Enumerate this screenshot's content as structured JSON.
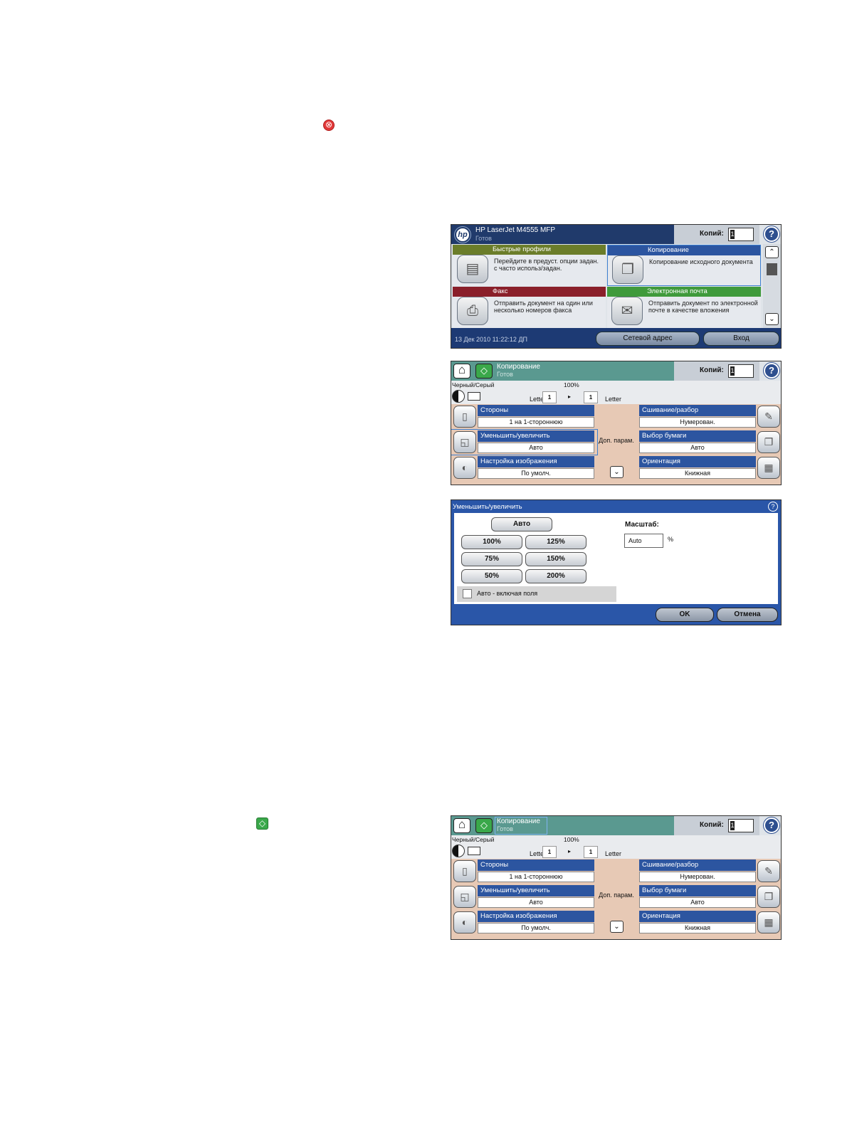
{
  "home_screen": {
    "device_name": "HP LaserJet M4555 MFP",
    "status": "Готов",
    "copies_label": "Копий:",
    "copies_value": "1",
    "tiles": [
      {
        "name": "Быстрые профили",
        "desc": "Перейдите в предуст. опции задан. с часто использ/задан.",
        "color": "#6b7d2a"
      },
      {
        "name": "Копирование",
        "desc": "Копирование исходного документа",
        "color": "#2c55a0"
      },
      {
        "name": "Факс",
        "desc": "Отправить документ на один или несколько номеров факса",
        "color": "#8a1f2a"
      },
      {
        "name": "Электронная почта",
        "desc": "Отправить документ по электронной почте в качестве вложения",
        "color": "#3f9a3b"
      }
    ],
    "datetime": "13 Дек 2010 11:22:12 ДП",
    "network_button": "Сетевой адрес",
    "login_button": "Вход"
  },
  "copy_screen": {
    "title": "Копирование",
    "status": "Готов",
    "copies_label": "Копий:",
    "copies_value": "1",
    "color_mode": "Черный/Серый",
    "zoom": "100%",
    "original_size": "Letter",
    "original_count": "1",
    "output_count": "1",
    "output_size": "Letter",
    "options_left": [
      {
        "label": "Стороны",
        "value": "1 на 1-стороннюю"
      },
      {
        "label": "Уменьшить/увеличить",
        "value": "Авто"
      },
      {
        "label": "Настройка изображения",
        "value": "По умолч."
      }
    ],
    "options_right": [
      {
        "label": "Сшивание/разбор",
        "value": "Нумерован."
      },
      {
        "label": "Выбор бумаги",
        "value": "Авто"
      },
      {
        "label": "Ориентация",
        "value": "Книжная"
      }
    ],
    "more_options": "Доп. парам."
  },
  "reduce_dialog": {
    "title": "Уменьшить/увеличить",
    "auto_button": "Авто",
    "presets": [
      "100%",
      "125%",
      "75%",
      "150%",
      "50%",
      "200%"
    ],
    "scale_label": "Масштаб:",
    "scale_value": "Auto",
    "percent_sign": "%",
    "checkbox_label": "Авто - включая поля",
    "ok_button": "OK",
    "cancel_button": "Отмена"
  },
  "icons": [
    "stop-icon",
    "start-icon",
    "home-icon",
    "help-icon"
  ]
}
